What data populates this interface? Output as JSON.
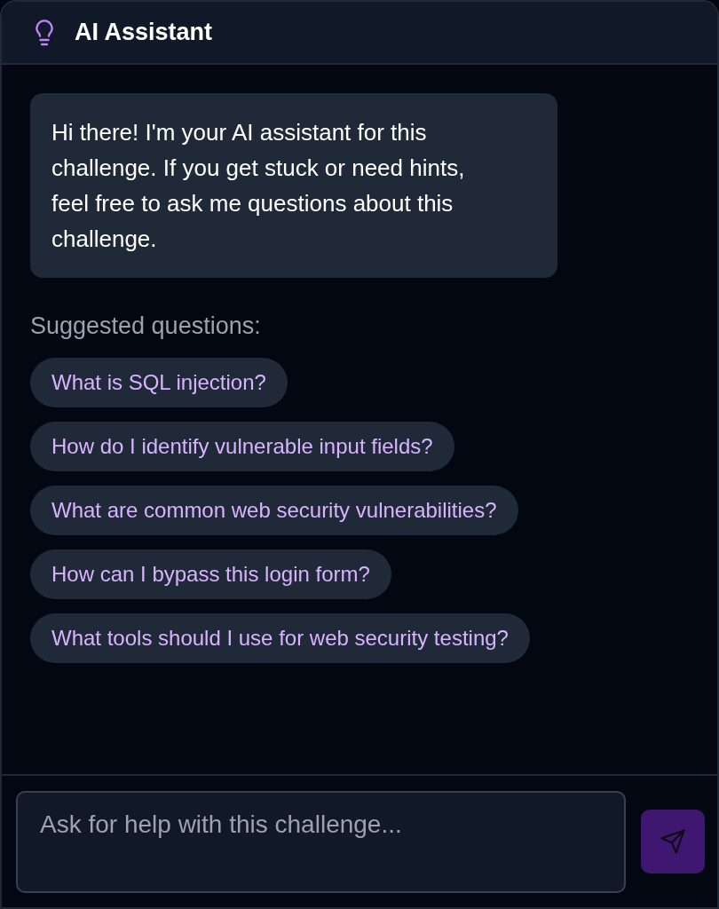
{
  "header": {
    "title": "AI Assistant"
  },
  "messages": [
    {
      "kind": "assistant",
      "text": "Hi there! I'm your AI assistant for this challenge. If you get stuck or need hints, feel free to ask me questions about this challenge."
    }
  ],
  "suggestions": {
    "label": "Suggested questions:",
    "items": [
      "What is SQL injection?",
      "How do I identify vulnerable input fields?",
      "What are common web security vulnerabilities?",
      "How can I bypass this login form?",
      "What tools should I use for web security testing?"
    ]
  },
  "composer": {
    "placeholder": "Ask for help with this challenge..."
  }
}
